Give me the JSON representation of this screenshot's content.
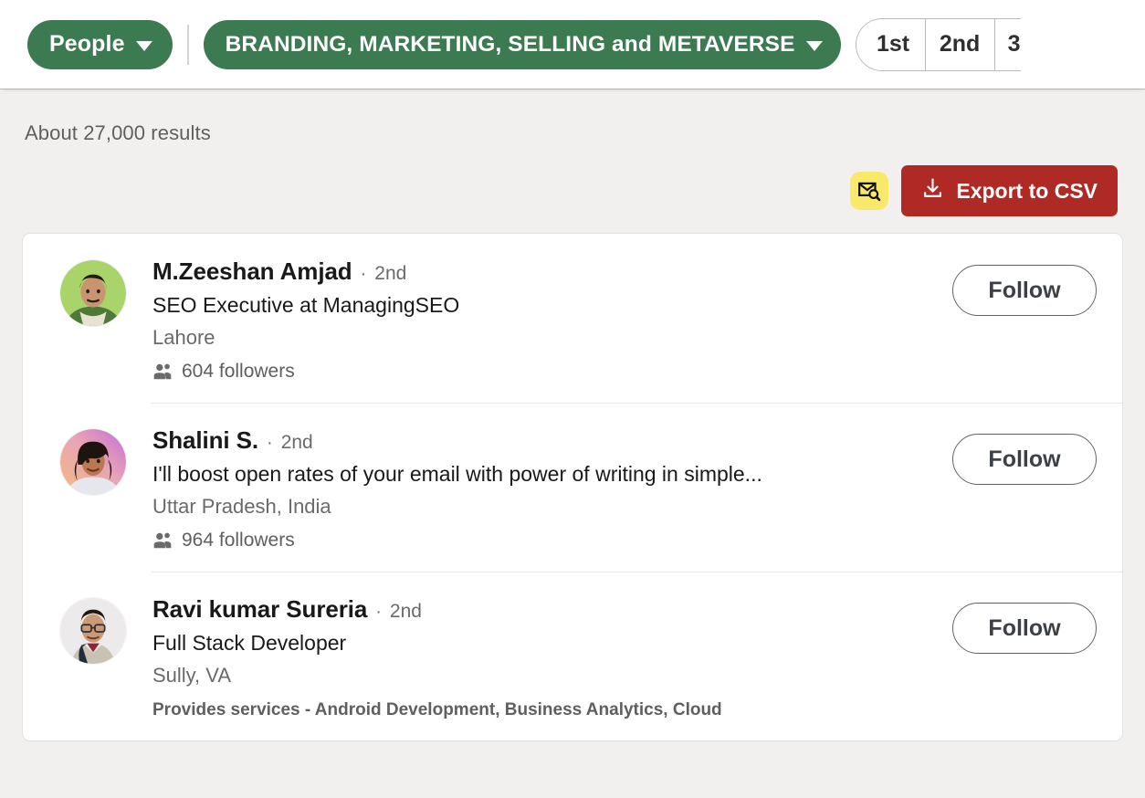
{
  "filter_bar": {
    "people_filter": {
      "label": "People",
      "icon": "chevron-down-icon"
    },
    "keyword_filter": {
      "label": "BRANDING, MARKETING, SELLING and METAVERSE",
      "icon": "chevron-down-icon"
    },
    "connection_degrees": [
      "1st",
      "2nd",
      "3"
    ]
  },
  "results": {
    "count_text": "About 27,000 results",
    "mail_finder_icon": "envelope-search-icon",
    "export_button": {
      "label": "Export to CSV",
      "icon": "download-icon"
    },
    "items": [
      {
        "name": "M.Zeeshan Amjad",
        "separator": "·",
        "degree": "2nd",
        "headline": "SEO Executive at ManagingSEO",
        "location": "Lahore",
        "followers": "604 followers",
        "services": "",
        "action_label": "Follow"
      },
      {
        "name": "Shalini S.",
        "separator": "·",
        "degree": "2nd",
        "headline": "I'll boost open rates of your email with power of writing in simple...",
        "location": "Uttar Pradesh, India",
        "followers": "964 followers",
        "services": "",
        "action_label": "Follow"
      },
      {
        "name": "Ravi kumar Sureria",
        "separator": "·",
        "degree": "2nd",
        "headline": "Full Stack Developer",
        "location": "Sully, VA",
        "followers": "",
        "services": "Provides services - Android Development, Business Analytics, Cloud",
        "action_label": "Follow"
      }
    ]
  },
  "colors": {
    "brand_green": "#3c7a52",
    "export_red": "#b02a25",
    "mail_finder_yellow": "#f9e96b",
    "page_background": "#f1f0ee"
  }
}
